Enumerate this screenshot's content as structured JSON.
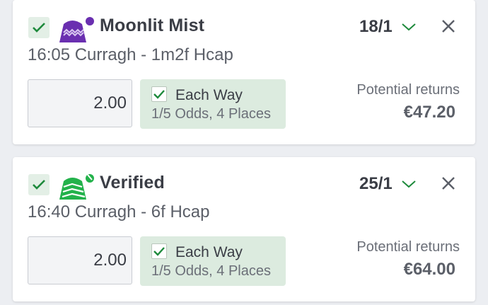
{
  "colors": {
    "accent": "#1e8a3c",
    "card_bg": "#ffffff",
    "ew_bg": "#dcebdf"
  },
  "bets": [
    {
      "runner": "Moonlit Mist",
      "odds": "18/1",
      "race": "16:05 Curragh - 1m2f Hcap",
      "stake": "2.00",
      "each_way_label": "Each Way",
      "each_way_terms": "1/5 Odds, 4 Places",
      "potential_returns_label": "Potential returns",
      "potential_returns": "€47.20",
      "silk_colors": [
        "#6a2fb0",
        "#d9c8f0"
      ]
    },
    {
      "runner": "Verified",
      "odds": "25/1",
      "race": "16:40 Curragh - 6f Hcap",
      "stake": "2.00",
      "each_way_label": "Each Way",
      "each_way_terms": "1/5 Odds, 4 Places",
      "potential_returns_label": "Potential returns",
      "potential_returns": "€64.00",
      "silk_colors": [
        "#23b24b",
        "#ffffff"
      ]
    }
  ]
}
